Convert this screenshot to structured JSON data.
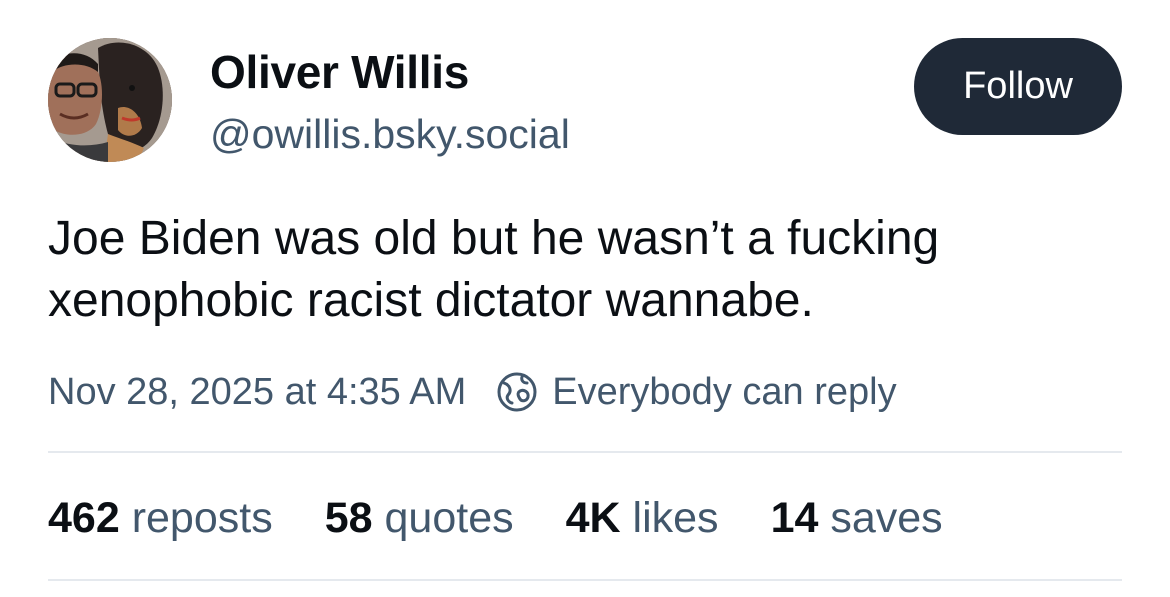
{
  "author": {
    "display_name": "Oliver Willis",
    "handle": "@owillis.bsky.social"
  },
  "follow_button": {
    "label": "Follow"
  },
  "post": {
    "text": "Joe Biden was old but he wasn’t a fucking xenophobic racist dictator wannabe.",
    "timestamp": "Nov 28, 2025 at 4:35 AM",
    "reply_setting": "Everybody can reply",
    "reply_setting_icon": "globe-icon"
  },
  "stats": [
    {
      "count": "462",
      "label": "reposts"
    },
    {
      "count": "58",
      "label": "quotes"
    },
    {
      "count": "4K",
      "label": "likes"
    },
    {
      "count": "14",
      "label": "saves"
    }
  ],
  "colors": {
    "text_primary": "#0b0f14",
    "text_secondary": "#42576c",
    "button_bg": "#1f2937",
    "divider": "#e5e9ee"
  }
}
